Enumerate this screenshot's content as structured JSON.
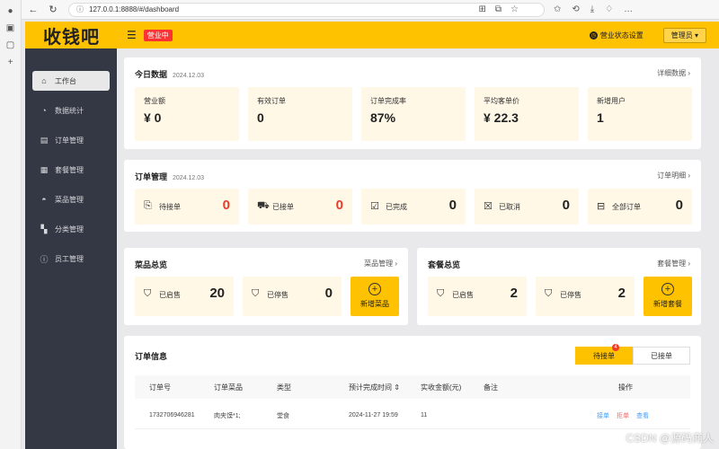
{
  "browser": {
    "url": "127.0.0.1:8888/#/dashboard"
  },
  "header": {
    "logo": "收钱吧",
    "status_tag": "营业中",
    "settings_label": "营业状态设置",
    "admin_label": "管理员"
  },
  "sidebar": {
    "items": [
      {
        "label": "工作台",
        "icon": "home-icon"
      },
      {
        "label": "数据统计",
        "icon": "chart-icon"
      },
      {
        "label": "订单管理",
        "icon": "order-icon"
      },
      {
        "label": "套餐管理",
        "icon": "combo-icon"
      },
      {
        "label": "菜品管理",
        "icon": "dish-icon"
      },
      {
        "label": "分类管理",
        "icon": "category-icon"
      },
      {
        "label": "员工管理",
        "icon": "staff-icon"
      }
    ]
  },
  "today": {
    "title": "今日数据",
    "date": "2024.12.03",
    "link": "详细数据",
    "stats": [
      {
        "label": "营业额",
        "value": "¥ 0"
      },
      {
        "label": "有效订单",
        "value": "0"
      },
      {
        "label": "订单完成率",
        "value": "87%"
      },
      {
        "label": "平均客单价",
        "value": "¥ 22.3"
      },
      {
        "label": "新增用户",
        "value": "1"
      }
    ]
  },
  "orders": {
    "title": "订单管理",
    "date": "2024.12.03",
    "link": "订单明细",
    "items": [
      {
        "label": "待接单",
        "value": "0"
      },
      {
        "label": "已接单",
        "value": "0"
      },
      {
        "label": "已完成",
        "value": "0"
      },
      {
        "label": "已取消",
        "value": "0"
      },
      {
        "label": "全部订单",
        "value": "0"
      }
    ]
  },
  "dishes": {
    "title": "菜品总览",
    "link": "菜品管理",
    "on_label": "已启售",
    "on_value": "20",
    "off_label": "已停售",
    "off_value": "0",
    "add_label": "新增菜品"
  },
  "combos": {
    "title": "套餐总览",
    "link": "套餐管理",
    "on_label": "已启售",
    "on_value": "2",
    "off_label": "已停售",
    "off_value": "2",
    "add_label": "新增套餐"
  },
  "order_info": {
    "title": "订单信息",
    "tab_pending": "待接单",
    "tab_pending_badge": "4",
    "tab_accepted": "已接单",
    "columns": [
      "订单号",
      "订单菜品",
      "类型",
      "预计完成时间",
      "实收金额(元)",
      "备注",
      "操作"
    ],
    "rows": [
      {
        "id": "1732706946281",
        "dish": "肉夹馍*1;",
        "type": "堂食",
        "time": "2024-11-27 19:59",
        "amount": "11",
        "remark": "",
        "actions": [
          "接单",
          "拒单",
          "查看"
        ]
      }
    ]
  },
  "watermark": "CSDN @源码商人"
}
